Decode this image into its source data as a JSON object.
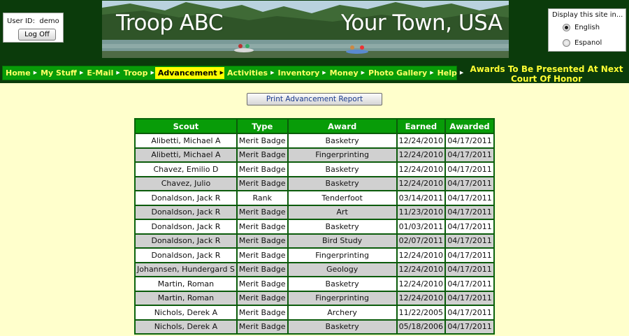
{
  "login": {
    "user_id_label": "User ID:",
    "user_id": "demo",
    "logoff_label": "Log Off"
  },
  "banner": {
    "left_text": "Troop ABC",
    "right_text": "Your Town, USA"
  },
  "language": {
    "title": "Display this site in...",
    "options": [
      {
        "label": "English",
        "selected": true
      },
      {
        "label": "Espanol",
        "selected": false
      }
    ]
  },
  "nav": {
    "items": [
      {
        "label": "Home"
      },
      {
        "label": "My Stuff"
      },
      {
        "label": "E-Mail"
      },
      {
        "label": "Troop"
      },
      {
        "label": "Advancement",
        "active": true
      },
      {
        "label": "Activities"
      },
      {
        "label": "Inventory"
      },
      {
        "label": "Money"
      },
      {
        "label": "Photo Gallery"
      },
      {
        "label": "Help"
      }
    ],
    "heading": "Awards To Be Presented At Next Court Of Honor"
  },
  "report": {
    "print_label": "Print Advancement Report"
  },
  "table": {
    "headers": [
      "Scout",
      "Type",
      "Award",
      "Earned",
      "Awarded"
    ],
    "rows": [
      [
        "Alibetti, Michael A",
        "Merit Badge",
        "Basketry",
        "12/24/2010",
        "04/17/2011"
      ],
      [
        "Alibetti, Michael A",
        "Merit Badge",
        "Fingerprinting",
        "12/24/2010",
        "04/17/2011"
      ],
      [
        "Chavez, Emilio D",
        "Merit Badge",
        "Basketry",
        "12/24/2010",
        "04/17/2011"
      ],
      [
        "Chavez, Julio",
        "Merit Badge",
        "Basketry",
        "12/24/2010",
        "04/17/2011"
      ],
      [
        "Donaldson, Jack R",
        "Rank",
        "Tenderfoot",
        "03/14/2011",
        "04/17/2011"
      ],
      [
        "Donaldson, Jack R",
        "Merit Badge",
        "Art",
        "11/23/2010",
        "04/17/2011"
      ],
      [
        "Donaldson, Jack R",
        "Merit Badge",
        "Basketry",
        "01/03/2011",
        "04/17/2011"
      ],
      [
        "Donaldson, Jack R",
        "Merit Badge",
        "Bird Study",
        "02/07/2011",
        "04/17/2011"
      ],
      [
        "Donaldson, Jack R",
        "Merit Badge",
        "Fingerprinting",
        "12/24/2010",
        "04/17/2011"
      ],
      [
        "Johannsen, Hundergard S",
        "Merit Badge",
        "Geology",
        "12/24/2010",
        "04/17/2011"
      ],
      [
        "Martin, Roman",
        "Merit Badge",
        "Basketry",
        "12/24/2010",
        "04/17/2011"
      ],
      [
        "Martin, Roman",
        "Merit Badge",
        "Fingerprinting",
        "12/24/2010",
        "04/17/2011"
      ],
      [
        "Nichols, Derek A",
        "Merit Badge",
        "Archery",
        "11/22/2005",
        "04/17/2011"
      ],
      [
        "Nichols, Derek A",
        "Merit Badge",
        "Basketry",
        "05/18/2006",
        "04/17/2011"
      ]
    ]
  }
}
